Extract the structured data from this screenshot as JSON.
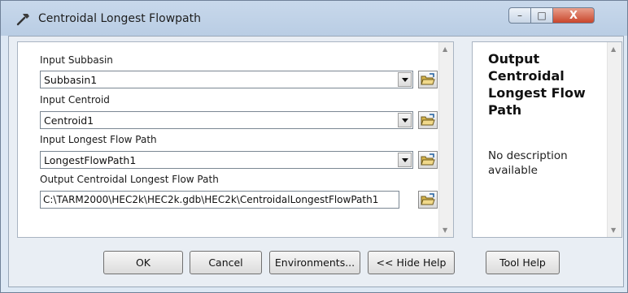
{
  "window": {
    "title": "Centroidal Longest Flowpath",
    "controls": {
      "minimize": "–",
      "maximize": "□",
      "close": "X"
    }
  },
  "params": [
    {
      "label": "Input Subbasin",
      "value": "Subbasin1",
      "type": "combo"
    },
    {
      "label": "Input Centroid",
      "value": "Centroid1",
      "type": "combo"
    },
    {
      "label": "Input Longest Flow Path",
      "value": "LongestFlowPath1",
      "type": "combo"
    },
    {
      "label": "Output Centroidal Longest Flow Path",
      "value": "C:\\TARM2000\\HEC2k\\HEC2k.gdb\\HEC2k\\CentroidalLongestFlowPath1",
      "type": "text"
    }
  ],
  "help": {
    "title": "Output Centroidal Longest Flow Path",
    "description": "No description available"
  },
  "buttons": {
    "ok": "OK",
    "cancel": "Cancel",
    "environments": "Environments...",
    "hide_help": "<< Hide Help",
    "tool_help": "Tool Help"
  },
  "icons": {
    "title": "tool-hammer-icon",
    "browse": "open-folder-icon",
    "dropdown": "chevron-down-icon"
  }
}
